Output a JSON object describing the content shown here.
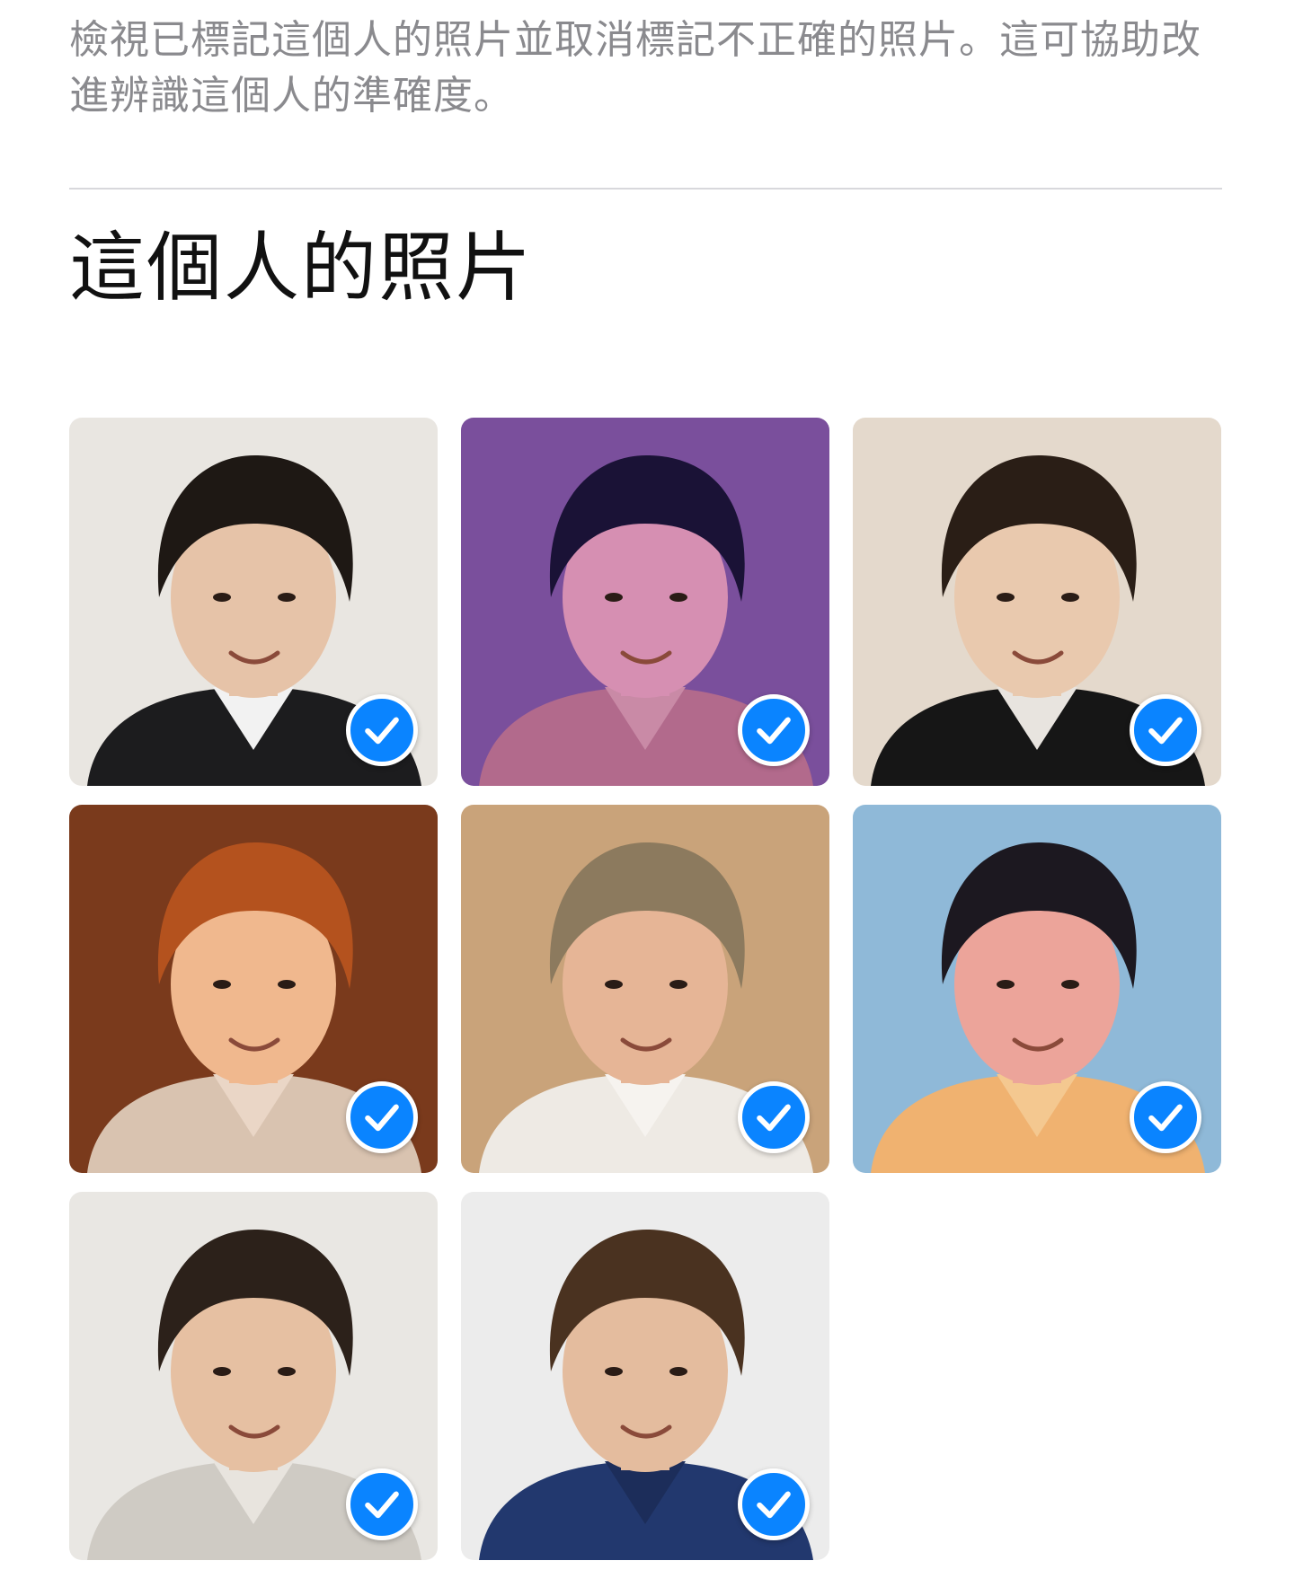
{
  "header": {
    "description": "檢視已標記這個人的照片並取消標記不正確的照片。這可協助改進辨識這個人的準確度。",
    "section_title": "這個人的照片"
  },
  "photos": [
    {
      "selected": true,
      "bg": "#e9e6e1",
      "hair": "#1e1814",
      "skin": "#e6c3a8",
      "shirt": "#1c1c1e",
      "collar": "#f2f2f2"
    },
    {
      "selected": true,
      "bg": "#7a4f9c",
      "hair": "#1a1236",
      "skin": "#d68fb2",
      "shirt": "#b26a8c",
      "collar": "#c98aa6"
    },
    {
      "selected": true,
      "bg": "#e4d9cc",
      "hair": "#2a1e16",
      "skin": "#e9c9ae",
      "shirt": "#161616",
      "collar": "#e8e4df"
    },
    {
      "selected": true,
      "bg": "#7a3a1c",
      "hair": "#b4521e",
      "skin": "#f0b88e",
      "shirt": "#d9c3b0",
      "collar": "#ead6c6"
    },
    {
      "selected": true,
      "bg": "#c9a37a",
      "hair": "#8c7a5e",
      "skin": "#e6b596",
      "shirt": "#eeeae4",
      "collar": "#f6f3ef"
    },
    {
      "selected": true,
      "bg": "#8fb9d8",
      "hair": "#1c1820",
      "skin": "#eca49a",
      "shirt": "#f0b270",
      "collar": "#f4c890"
    },
    {
      "selected": true,
      "bg": "#e9e7e3",
      "hair": "#2c211a",
      "skin": "#e6c0a2",
      "shirt": "#cfcbc4",
      "collar": "#e8e4de"
    },
    {
      "selected": true,
      "bg": "#ececec",
      "hair": "#4a3220",
      "skin": "#e4bc9e",
      "shirt": "#22386e",
      "collar": "#1c2d5a"
    }
  ],
  "icons": {
    "check": "checkmark-circle-icon"
  },
  "colors": {
    "accent": "#0a84ff",
    "secondary_text": "#8a8a8e",
    "divider": "#d8d8dc"
  }
}
